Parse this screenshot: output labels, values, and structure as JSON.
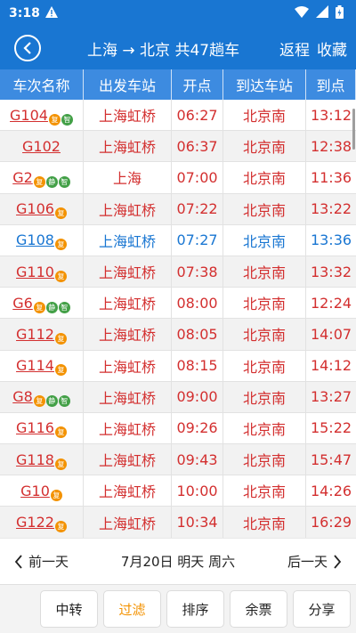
{
  "status_bar": {
    "time": "3:18"
  },
  "header": {
    "title": "上海 → 北京 共47趟车",
    "return_label": "返程",
    "favorite_label": "收藏"
  },
  "columns": [
    "车次名称",
    "出发车站",
    "开点",
    "到达车站",
    "到点"
  ],
  "trains": [
    {
      "no": "G104",
      "badges": [
        "复",
        "智"
      ],
      "from": "上海虹桥",
      "dep": "06:27",
      "to": "北京南",
      "arr": "13:12",
      "color": "#d32f2f"
    },
    {
      "no": "G102",
      "badges": [],
      "from": "上海虹桥",
      "dep": "06:37",
      "to": "北京南",
      "arr": "12:38",
      "color": "#d32f2f"
    },
    {
      "no": "G2",
      "badges": [
        "复",
        "静",
        "智"
      ],
      "from": "上海",
      "dep": "07:00",
      "to": "北京南",
      "arr": "11:36",
      "color": "#d32f2f"
    },
    {
      "no": "G106",
      "badges": [
        "复"
      ],
      "from": "上海虹桥",
      "dep": "07:22",
      "to": "北京南",
      "arr": "13:22",
      "color": "#d32f2f"
    },
    {
      "no": "G108",
      "badges": [
        "复"
      ],
      "from": "上海虹桥",
      "dep": "07:27",
      "to": "北京南",
      "arr": "13:36",
      "color": "#1976d2"
    },
    {
      "no": "G110",
      "badges": [
        "复"
      ],
      "from": "上海虹桥",
      "dep": "07:38",
      "to": "北京南",
      "arr": "13:32",
      "color": "#d32f2f"
    },
    {
      "no": "G6",
      "badges": [
        "复",
        "静",
        "智"
      ],
      "from": "上海虹桥",
      "dep": "08:00",
      "to": "北京南",
      "arr": "12:24",
      "color": "#d32f2f"
    },
    {
      "no": "G112",
      "badges": [
        "复"
      ],
      "from": "上海虹桥",
      "dep": "08:05",
      "to": "北京南",
      "arr": "14:07",
      "color": "#d32f2f"
    },
    {
      "no": "G114",
      "badges": [
        "复"
      ],
      "from": "上海虹桥",
      "dep": "08:15",
      "to": "北京南",
      "arr": "14:12",
      "color": "#d32f2f"
    },
    {
      "no": "G8",
      "badges": [
        "复",
        "静",
        "智"
      ],
      "from": "上海虹桥",
      "dep": "09:00",
      "to": "北京南",
      "arr": "13:27",
      "color": "#d32f2f"
    },
    {
      "no": "G116",
      "badges": [
        "复"
      ],
      "from": "上海虹桥",
      "dep": "09:26",
      "to": "北京南",
      "arr": "15:22",
      "color": "#d32f2f"
    },
    {
      "no": "G118",
      "badges": [
        "复"
      ],
      "from": "上海虹桥",
      "dep": "09:43",
      "to": "北京南",
      "arr": "15:47",
      "color": "#d32f2f"
    },
    {
      "no": "G10",
      "badges": [
        "复"
      ],
      "from": "上海虹桥",
      "dep": "10:00",
      "to": "北京南",
      "arr": "14:26",
      "color": "#d32f2f"
    },
    {
      "no": "G122",
      "badges": [
        "复"
      ],
      "from": "上海虹桥",
      "dep": "10:34",
      "to": "北京南",
      "arr": "16:29",
      "color": "#d32f2f"
    }
  ],
  "date_bar": {
    "prev_label": "前一天",
    "date_label": "7月20日 明天 周六",
    "next_label": "后一天"
  },
  "toolbar": {
    "buttons": [
      "中转",
      "过滤",
      "排序",
      "余票",
      "分享"
    ],
    "active_index": 1
  },
  "colors": {
    "primary": "#1976d2",
    "header_row": "#3d8be0",
    "accent": "#f39200",
    "text_red": "#d32f2f",
    "badge_green": "#43a047"
  }
}
